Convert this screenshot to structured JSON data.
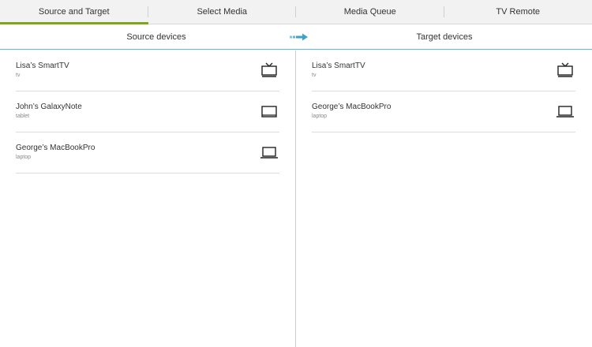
{
  "tabs": [
    {
      "label": "Source and Target",
      "active": true
    },
    {
      "label": "Select Media",
      "active": false
    },
    {
      "label": "Media Queue",
      "active": false
    },
    {
      "label": "TV Remote",
      "active": false
    }
  ],
  "header": {
    "source_label": "Source devices",
    "target_label": "Target devices"
  },
  "source_devices": [
    {
      "name": "Lisa’s SmartTV",
      "type": "tv",
      "icon": "tv-icon"
    },
    {
      "name": "John’s GalaxyNote",
      "type": "tablet",
      "icon": "tablet-icon"
    },
    {
      "name": "George’s MacBookPro",
      "type": "laptop",
      "icon": "laptop-icon"
    }
  ],
  "target_devices": [
    {
      "name": "Lisa’s SmartTV",
      "type": "tv",
      "icon": "tv-icon"
    },
    {
      "name": "George’s MacBookPro",
      "type": "laptop",
      "icon": "laptop-icon"
    }
  ],
  "colors": {
    "active_tab": "#7fa519",
    "accent_blue": "#3aa3c9"
  }
}
